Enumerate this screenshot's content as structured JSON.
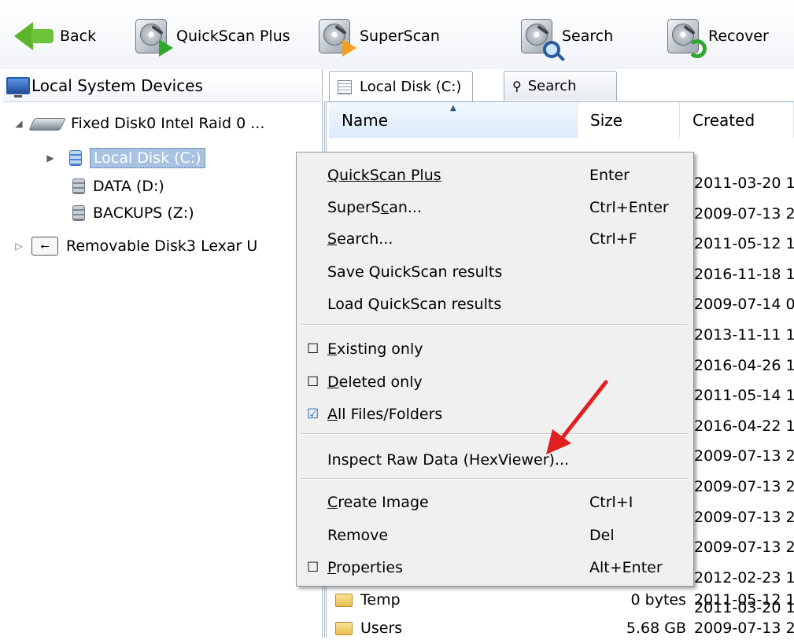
{
  "toolbar": {
    "back": "Back",
    "quickscan_plus": "QuickScan Plus",
    "superscan": "SuperScan",
    "search": "Search",
    "recover": "Recover"
  },
  "left": {
    "title": "Local System Devices",
    "tree": [
      {
        "label": "Fixed Disk0 Intel   Raid 0 ..."
      },
      {
        "label": "Local Disk (C:)"
      },
      {
        "label": "DATA (D:)"
      },
      {
        "label": "BACKUPS (Z:)"
      },
      {
        "label": "Removable Disk3 Lexar U"
      }
    ]
  },
  "right": {
    "tabs": [
      {
        "label": "Local Disk (C:)"
      },
      {
        "label": "Search"
      }
    ],
    "columns": {
      "name": "Name",
      "size": "Size",
      "created": "Created"
    },
    "created_dates": [
      "2011-03-20 1",
      "2009-07-13 2",
      "2011-05-12 1",
      "2016-11-18 1",
      "2009-07-14 0",
      "2013-11-11 1",
      "2016-04-26 1",
      "2011-05-14 1",
      "2016-04-22 1",
      "2009-07-13 2",
      "2009-07-13 2",
      "2009-07-13 2",
      "2009-07-13 2",
      "2012-02-23 1",
      "2011-03-20 1"
    ],
    "files": [
      {
        "name": "Temp",
        "size": "0 bytes",
        "created": "2011-05-12 1"
      },
      {
        "name": "Users",
        "size": "5.68 GB",
        "created": "2009-07-13 2"
      }
    ]
  },
  "context_menu": {
    "quickscan_plus": "QuickScan Plus",
    "quickscan_plus_sc": "Enter",
    "superscan_pre": "SuperS",
    "superscan_u": "c",
    "superscan_post": "an...",
    "superscan_sc": "Ctrl+Enter",
    "search_u": "S",
    "search_post": "earch...",
    "search_sc": "Ctrl+F",
    "save_results": "Save QuickScan results",
    "load_results": "Load QuickScan results",
    "existing_u": "E",
    "existing_post": "xisting only",
    "deleted_u": "D",
    "deleted_post": "eleted only",
    "all_u": "A",
    "all_post": "ll Files/Folders",
    "inspect": "Inspect Raw Data (HexViewer)...",
    "create_u": "C",
    "create_post": "reate Image",
    "create_sc": "Ctrl+I",
    "remove": "Remove",
    "remove_sc": "Del",
    "properties_u": "P",
    "properties_post": "roperties",
    "properties_sc": "Alt+Enter"
  },
  "colors": {
    "accent": "#a8c3e2",
    "annotation": "#e02020"
  }
}
